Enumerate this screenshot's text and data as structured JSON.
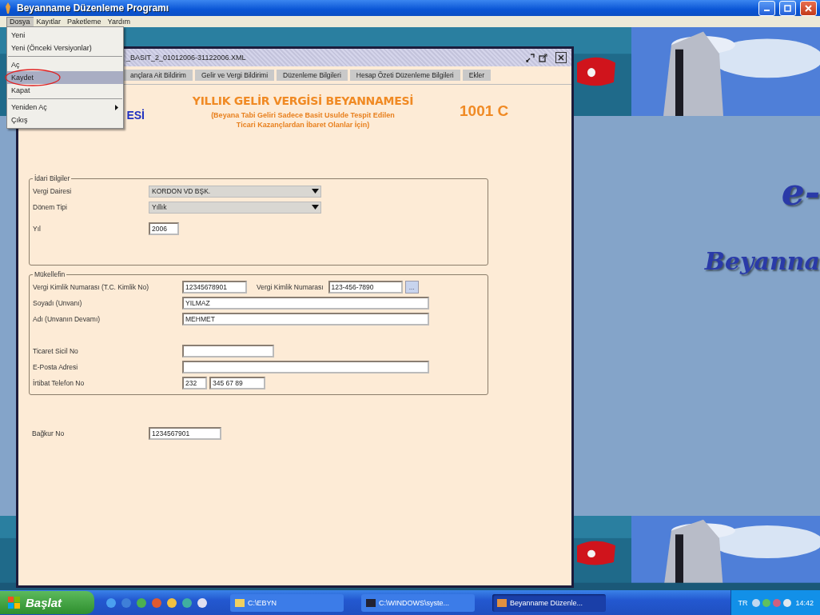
{
  "window": {
    "title": "Beyanname Düzenleme Programı"
  },
  "menu_bar": [
    {
      "label": "Dosya",
      "selected": true
    },
    {
      "label": "Kayıtlar",
      "selected": false
    },
    {
      "label": "Paketleme",
      "selected": false
    },
    {
      "label": "Yardım",
      "selected": false
    }
  ],
  "dosya_menu": [
    {
      "kind": "item",
      "label": "Yeni",
      "selected": false
    },
    {
      "kind": "item",
      "label": "Yeni (Önceki Versiyonlar)",
      "selected": false
    },
    {
      "kind": "separator"
    },
    {
      "kind": "item",
      "label": "Aç",
      "selected": false
    },
    {
      "kind": "item",
      "label": "Kaydet",
      "selected": true
    },
    {
      "kind": "item",
      "label": "Kapat",
      "selected": false
    },
    {
      "kind": "separator"
    },
    {
      "kind": "submenu",
      "label": "Yeniden Aç",
      "selected": false
    },
    {
      "kind": "item",
      "label": "Çıkış",
      "selected": false
    }
  ],
  "desktop": {
    "logo_top": "e-",
    "logo_bottom": "Beyanna"
  },
  "document_window": {
    "title": "_BASIT_2_01012006-31122006.XML",
    "tabs": [
      {
        "label": "ançlara Ait Bildirim",
        "selected": false
      },
      {
        "label": "Gelir ve Vergi Bildirimi",
        "selected": false
      },
      {
        "label": "Düzenleme Bilgileri",
        "selected": false
      },
      {
        "label": "Hesap Özeti Düzenleme Bilgileri",
        "selected": false
      },
      {
        "label": "Ekler",
        "selected": false
      }
    ],
    "header": {
      "fragment": "ESİ",
      "title": "YILLIK GELİR VERGİSİ BEYANNAMESİ",
      "subtitle": [
        "(Beyana Tabi Geliri Sadece Basit Usulde Tespit Edilen",
        "Ticari Kazançlardan İbaret Olanlar İçin)"
      ],
      "form_code": "1001 C"
    },
    "sections": [
      {
        "legend": "İdari Bilgiler",
        "rows": [
          {
            "label": "Vergi Dairesi",
            "fields": [
              {
                "kind": "select",
                "value": "KORDON VD BŞK."
              }
            ]
          },
          {
            "label": "Dönem Tipi",
            "fields": [
              {
                "kind": "select",
                "value": "Yıllık"
              }
            ]
          },
          {
            "label": "Yıl",
            "fields": [
              {
                "kind": "year",
                "value": "2006"
              }
            ]
          }
        ]
      },
      {
        "legend": "Mükellefin",
        "rows": [
          {
            "label": "Vergi Kimlik Numarası (T.C. Kimlik No)",
            "fields": [
              {
                "kind": "id",
                "value": "12345678901"
              },
              {
                "kind": "label",
                "value": "Vergi Kimlik Numarası"
              },
              {
                "kind": "tax_no",
                "value": "123-456-7890"
              },
              {
                "kind": "button",
                "value": "..."
              }
            ]
          },
          {
            "label": "Soyadı (Unvanı)",
            "fields": [
              {
                "kind": "name",
                "value": "YILMAZ"
              }
            ]
          },
          {
            "label": "Adı (Unvanın Devamı)",
            "fields": [
              {
                "kind": "name",
                "value": "MEHMET"
              }
            ]
          },
          {
            "label": "Ticaret Sicil No",
            "fields": [
              {
                "kind": "registry"
              }
            ]
          },
          {
            "label": "E-Posta Adresi",
            "fields": [
              {
                "kind": "name"
              }
            ]
          },
          {
            "label": "İrtibat Telefon No",
            "fields": [
              {
                "kind": "area_code",
                "value": "232"
              },
              {
                "kind": "phone",
                "value": "345 67 89"
              }
            ]
          }
        ]
      }
    ],
    "bagkur": {
      "label": "Bağkur No",
      "value": "1234567901"
    }
  },
  "taskbar": {
    "start": "Başlat",
    "tasks": [
      {
        "label": "C:\\EBYN",
        "selected": false
      },
      {
        "label": "C:\\WINDOWS\\syste...",
        "selected": false
      },
      {
        "label": "Beyanname Düzenle...",
        "selected": true
      }
    ],
    "language": "TR",
    "clock": "14:42"
  }
}
